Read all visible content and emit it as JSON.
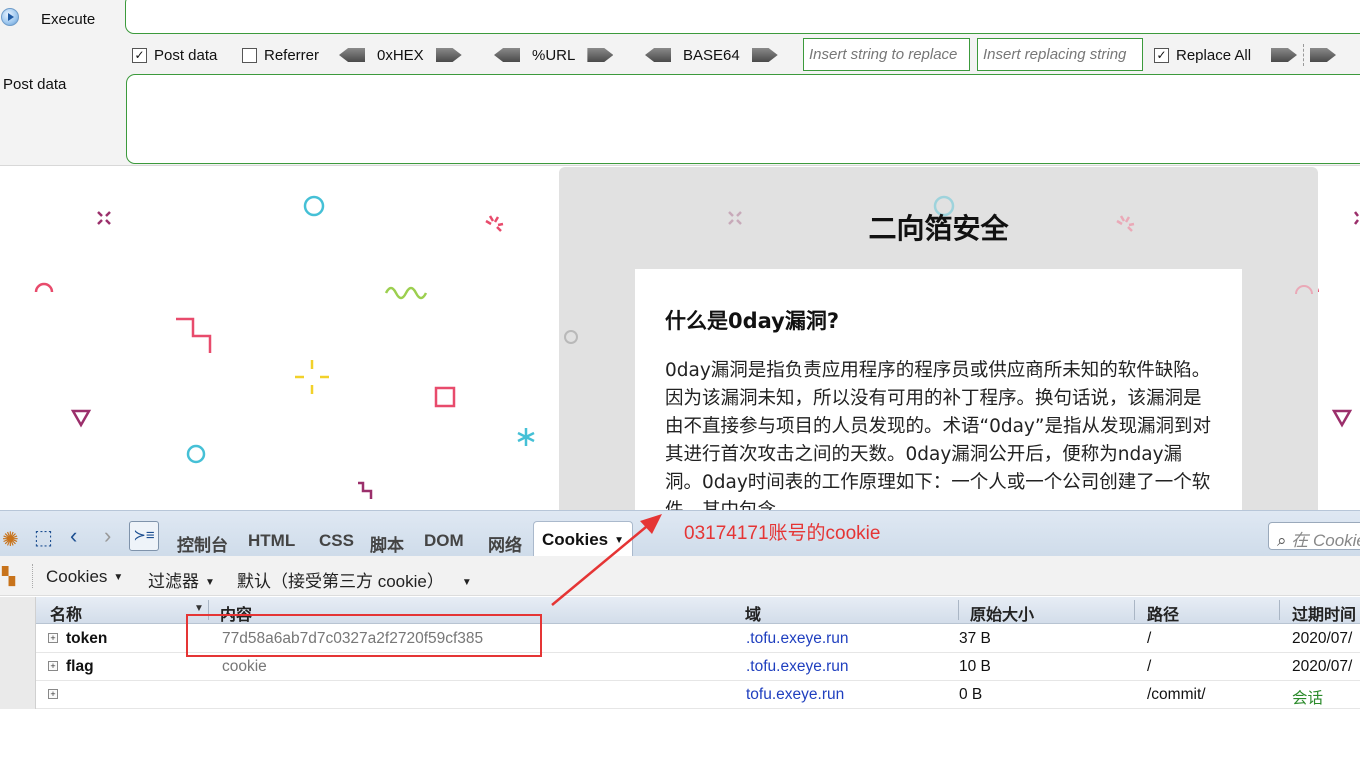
{
  "hackbar": {
    "execute_label": "Execute",
    "post_data_checkbox": {
      "label": "Post data",
      "checked": true
    },
    "referrer_checkbox": {
      "label": "Referrer",
      "checked": false
    },
    "encoders": [
      "0xHEX",
      "%URL",
      "BASE64"
    ],
    "replace_input_placeholder": "Insert string to replace",
    "replacing_input_placeholder": "Insert replacing string",
    "replace_all": {
      "label": "Replace All",
      "checked": true
    },
    "post_data_label": "Post data"
  },
  "page": {
    "site_title": "二向箔安全",
    "article_title": "什么是0day漏洞?",
    "article_body": "0day漏洞是指负责应用程序的程序员或供应商所未知的软件缺陷。因为该漏洞未知，所以没有可用的补丁程序。换句话说，该漏洞是由不直接参与项目的人员发现的。术语“0day”是指从发现漏洞到对其进行首次攻击之间的天数。0day漏洞公开后，便称为nday漏洞。0day时间表的工作原理如下：一个人或一个公司创建了一个软件，其中包含"
  },
  "firebug": {
    "tabs": [
      "控制台",
      "HTML",
      "CSS",
      "脚本",
      "DOM",
      "网络",
      "Cookies"
    ],
    "active_tab": "Cookies",
    "search_placeholder": "在 Cookies 中搜索",
    "toolbar": {
      "cookies_menu": "Cookies",
      "filter_menu": "过滤器",
      "default_menu": "默认（接受第三方 cookie）"
    },
    "columns": [
      "名称",
      "内容",
      "域",
      "原始大小",
      "路径",
      "过期时间"
    ],
    "rows": [
      {
        "name": "token",
        "content": "77d58a6ab7d7c0327a2f2720f59cf385",
        "domain": ".tofu.exeye.run",
        "size": "37 B",
        "path": "/",
        "expires": "2020/07/"
      },
      {
        "name": "flag",
        "content": "cookie",
        "domain": ".tofu.exeye.run",
        "size": "10 B",
        "path": "/",
        "expires": "2020/07/"
      },
      {
        "name": "",
        "content": "",
        "domain": "tofu.exeye.run",
        "size": "0 B",
        "path": "/commit/",
        "expires": "会话"
      }
    ]
  },
  "annotation": {
    "text": "03174171账号的cookie",
    "color": "#e53535"
  }
}
